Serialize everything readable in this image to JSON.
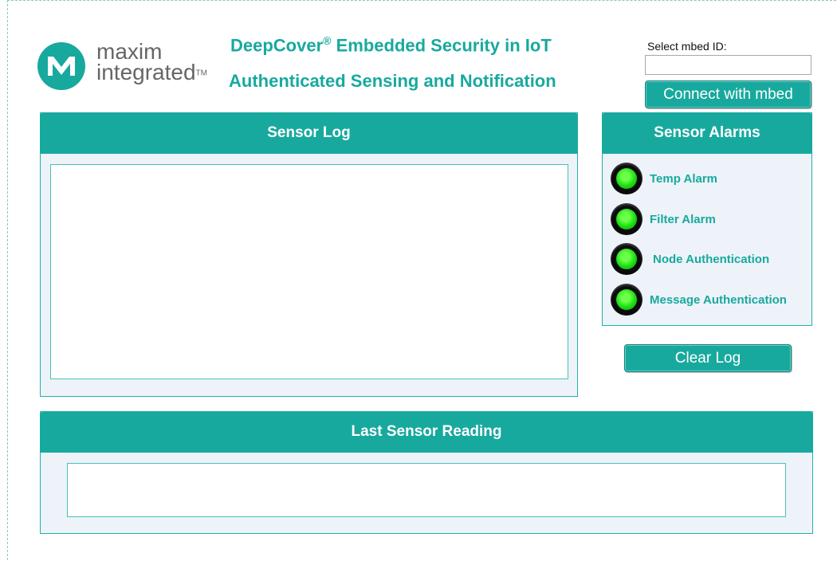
{
  "header": {
    "logo": {
      "line1": "maxim",
      "line2": "integrated",
      "tm": "TM"
    },
    "title_main": "DeepCover",
    "title_reg": "®",
    "title_rest": " Embedded Security in IoT",
    "subtitle": "Authenticated Sensing and Notification"
  },
  "mbed": {
    "label": "Select mbed ID:",
    "value": "",
    "connect_label": "Connect with mbed"
  },
  "sensor_log": {
    "title": "Sensor Log",
    "content": ""
  },
  "sensor_alarms": {
    "title": "Sensor Alarms",
    "items": [
      {
        "label": "Temp Alarm",
        "status": "ok"
      },
      {
        "label": "Filter Alarm",
        "status": "ok"
      },
      {
        "label": "Node Authentication",
        "status": "ok"
      },
      {
        "label": "Message Authentication",
        "status": "ok"
      }
    ]
  },
  "clear_log_label": "Clear Log",
  "last_reading": {
    "title": "Last Sensor Reading",
    "content": ""
  },
  "colors": {
    "accent": "#18a99e",
    "panel_bg": "#edf3f9",
    "led_green": "#1de012"
  }
}
